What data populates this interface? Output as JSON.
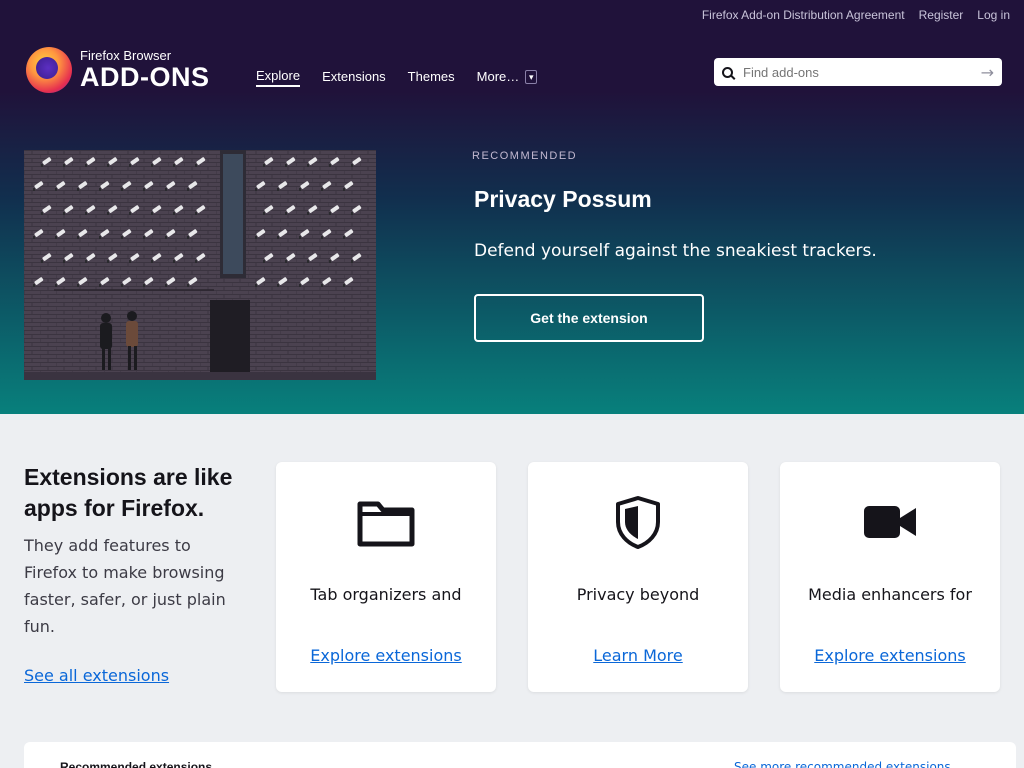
{
  "header": {
    "logo_small": "Firefox Browser",
    "logo_big": "ADD-ONS",
    "nav": [
      {
        "label": "Explore"
      },
      {
        "label": "Extensions"
      },
      {
        "label": "Themes"
      },
      {
        "label": "More…"
      }
    ],
    "top_links": [
      "Firefox Add-on Distribution Agreement",
      "Register",
      "Log in"
    ],
    "search": {
      "placeholder": "Find add-ons",
      "value": ""
    }
  },
  "hero": {
    "label": "RECOMMENDED",
    "title": "Privacy Possum",
    "description": "Defend yourself against the sneakiest trackers.",
    "button_label": "Get the extension"
  },
  "extensions": {
    "heading": "Extensions are like apps for Firefox.",
    "description": "They add features to Firefox to make browsing faster, safer, or just plain fun.",
    "link_label": "See all extensions",
    "cards": [
      {
        "icon": "folder-icon",
        "text": "Tab organizers and more",
        "link": "Explore extensions"
      },
      {
        "icon": "shield-icon",
        "text": "Privacy beyond",
        "link": "Learn More"
      },
      {
        "icon": "video-camera-icon",
        "text": "Media enhancers for",
        "link": "Explore extensions"
      }
    ]
  },
  "recommended_strip": {
    "title": "Recommended extensions",
    "link": "See more recommended extensions"
  },
  "colors": {
    "header_dark": "#20123a",
    "hero_teal": "#08807c",
    "link_blue": "#0a67d8",
    "section_bg": "#edeff2"
  }
}
